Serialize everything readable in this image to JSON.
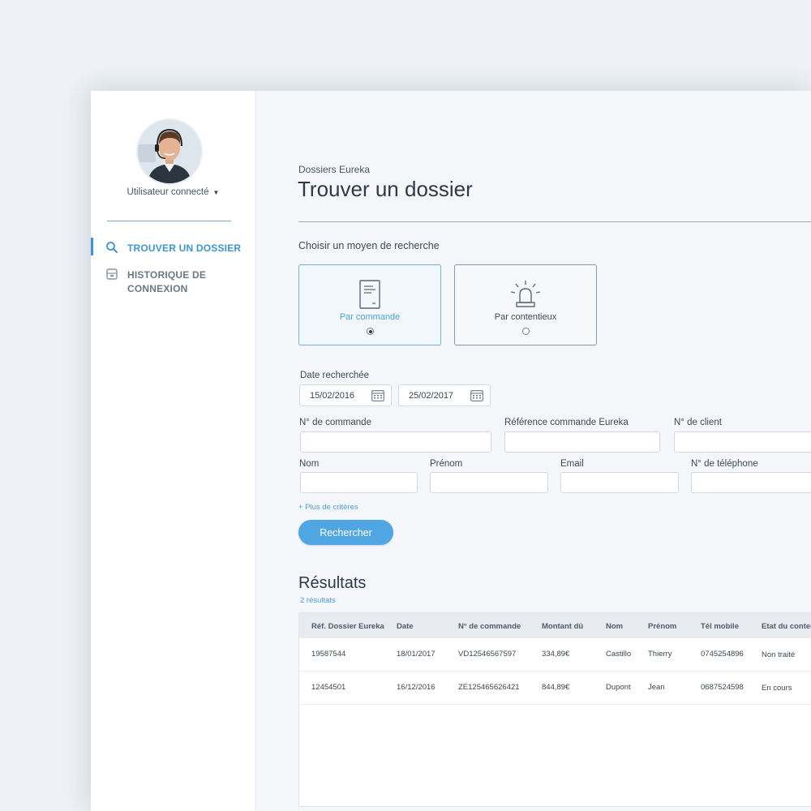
{
  "user": {
    "label": "Utilisateur connecté"
  },
  "nav": {
    "items": [
      {
        "label": "TROUVER UN DOSSIER",
        "active": true,
        "icon": "search-icon"
      },
      {
        "label": "HISTORIQUE DE CONNEXION",
        "active": false,
        "icon": "history-icon"
      }
    ]
  },
  "header": {
    "breadcrumb": "Dossiers Eureka",
    "title": "Trouver un dossier"
  },
  "search_mode": {
    "label": "Choisir un moyen de recherche",
    "options": [
      {
        "label": "Par commande",
        "selected": true,
        "icon": "document-icon"
      },
      {
        "label": "Par contentieux",
        "selected": false,
        "icon": "alarm-icon"
      }
    ]
  },
  "form": {
    "date_label": "Date recherchée",
    "date_from": "15/02/2016",
    "date_to": "25/02/2017",
    "order_number_label": "N° de commande",
    "order_number_value": "",
    "eureka_ref_label": "Référence commande Eureka",
    "eureka_ref_value": "",
    "client_number_label": "N° de client",
    "client_number_value": "",
    "last_name_label": "Nom",
    "last_name_value": "",
    "first_name_label": "Prénom",
    "first_name_value": "",
    "email_label": "Email",
    "email_value": "",
    "phone_label": "N° de téléphone",
    "phone_value": "",
    "more_criteria": "+ Plus de critères",
    "search_button": "Rechercher"
  },
  "results": {
    "title": "Résultats",
    "count": "2 résultats",
    "columns": [
      "Réf. Dossier Eureka",
      "Date",
      "N° de commande",
      "Montant dû",
      "Nom",
      "Prénom",
      "Tél mobile",
      "Etat du contentieux"
    ],
    "rows": [
      [
        "19587544",
        "18/01/2017",
        "VD12546567597",
        "334,89€",
        "Castillo",
        "Thierry",
        "0745254896",
        "Non traité"
      ],
      [
        "12454501",
        "16/12/2016",
        "ZE125465626421",
        "844,89€",
        "Dupont",
        "Jean",
        "0687524598",
        "En cours"
      ]
    ]
  },
  "colors": {
    "accent": "#4fa6e2",
    "nav_active": "#3d95d3"
  }
}
